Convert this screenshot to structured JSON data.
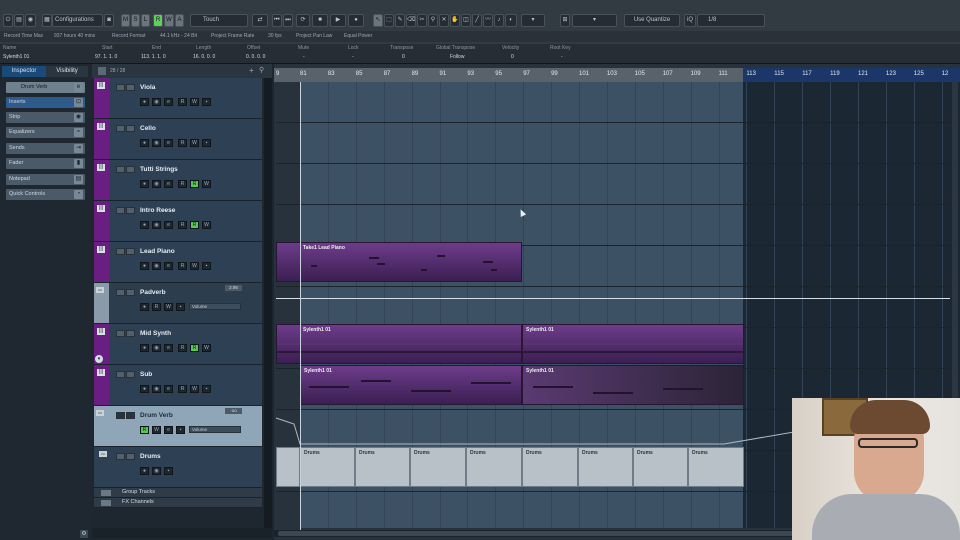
{
  "toolbar": {
    "configurations": "Configurations",
    "mode_buttons": [
      "M",
      "S",
      "L",
      "R",
      "W",
      "A"
    ],
    "automation_mode": "Touch",
    "quantize_mode": "Use Quantize",
    "grid": "1/8",
    "transport_icons": [
      "go-start-icon",
      "go-end-icon",
      "cycle-icon",
      "stop-icon",
      "play-icon",
      "record-icon"
    ],
    "tool_icons": [
      "pointer-icon",
      "range-icon",
      "pencil-icon",
      "erase-icon",
      "zoom-icon",
      "mute-icon",
      "split-icon",
      "glue-icon",
      "draw-icon",
      "line-icon",
      "play-tool-icon",
      "color-icon"
    ]
  },
  "status_bar": {
    "record_time_max": "Record Time Max",
    "record_time_value": "937 hours 40 mins",
    "record_format": "Record Format",
    "record_format_value": "44.1 kHz - 24 Bit",
    "frame_rate": "Project Frame Rate",
    "frame_rate_value": "30 fps",
    "pan_law": "Project Pan Law",
    "pan_law_value": "Equal Power"
  },
  "info_line": {
    "headers": [
      "Name",
      "Start",
      "End",
      "Length",
      "Offset",
      "Mute",
      "Lock",
      "Transpose",
      "Global Transpose",
      "Velocity",
      "Root Key"
    ],
    "values": [
      "Sylenth1 01",
      "97. 1. 1. 0",
      "113. 1. 1. 0",
      "16. 0. 0. 0",
      "0. 0. 0. 0",
      "-",
      "-",
      "0",
      "Follow",
      "0",
      "-"
    ]
  },
  "inspector": {
    "tab_inspector": "Inspector",
    "tab_visibility": "Visibility",
    "track_name": "Drum Verb",
    "sections": [
      "Inserts",
      "Strip",
      "Equalizers",
      "Sends",
      "Fader",
      "Notepad",
      "Quick Controls"
    ]
  },
  "tracklist": {
    "count": "28 / 28",
    "tracks": [
      {
        "name": "Viola"
      },
      {
        "name": "Cello"
      },
      {
        "name": "Tutti Strings"
      },
      {
        "name": "Intro Reese"
      },
      {
        "name": "Lead Piano"
      },
      {
        "name": "Padverb",
        "value": "2.95",
        "automation": "Volume"
      },
      {
        "name": "Mid Synth"
      },
      {
        "name": "Sub"
      },
      {
        "name": "Drum Verb",
        "value": "-oo",
        "automation": "Volume"
      },
      {
        "name": "Drums"
      }
    ],
    "folders": [
      "Group Tracks",
      "FX Channels"
    ]
  },
  "ruler": {
    "bars": [
      "9",
      "81",
      "83",
      "85",
      "87",
      "89",
      "91",
      "93",
      "95",
      "97",
      "99",
      "101",
      "103",
      "105",
      "107",
      "109",
      "111",
      "113",
      "115",
      "117",
      "119",
      "121",
      "123",
      "125",
      "12"
    ]
  },
  "parts": {
    "lead_piano": "Take1 Lead Piano",
    "mid_synth_a": "Sylenth1 01",
    "mid_synth_b": "Sylenth1 01",
    "sub_a": "Sylenth1 01",
    "sub_b": "Sylenth1 01",
    "drums": [
      "Drums",
      "Drums",
      "Drums",
      "Drums",
      "Drums",
      "Drums",
      "Drums",
      "Drums"
    ]
  },
  "colors": {
    "track_strip": "#6b1e82",
    "part_purple": "#6d3c8a",
    "ruler_blue": "#1b3769",
    "record_green": "#5fcf5b"
  }
}
